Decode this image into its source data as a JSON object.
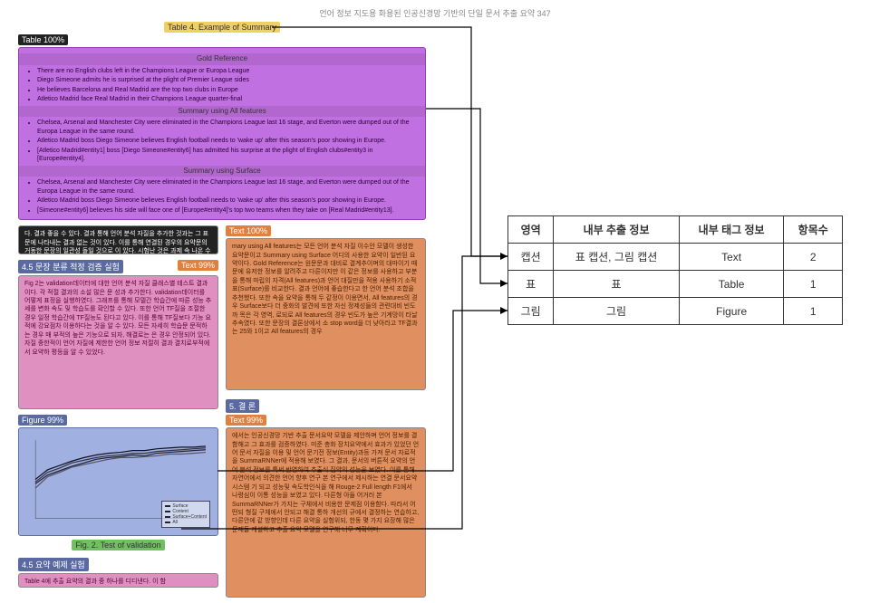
{
  "header_text": "언어 정보 지도용 화용된 인공신경망 기반의 단일 문서 추출 요약  347",
  "labels": {
    "table_caption": "Table 4. Example of Summary",
    "table_pct": "Table 100%",
    "text_pct": "Text 100%",
    "section_45_1": "4.5 문장 분류 적정 검증 실험",
    "text99_1": "Text 99%",
    "figure_pct": "Figure 99%",
    "text99_2": "Text 99%",
    "fig_caption": "Fig. 2. Test of validation",
    "section_45_2": "4.5 요약 예제 실험",
    "section_5": "5. 결 론"
  },
  "purple": {
    "hdr_gold": "Gold Reference",
    "gold_items": [
      "There are no English clubs left in the Champions League or Europa League",
      "Diego Simeone admits he is surprised at the plight of Premier League sides",
      "He believes Barcelona and Real Madrid are the top two clubs in Europe",
      "Atletico Madrid face Real Madrid in their Champions League quarter-final"
    ],
    "hdr_all": "Summary using All features",
    "all_items": [
      "Chelsea, Arsenal and Manchester City were eliminated in the Champions League last 16 stage, and Everton were dumped out of the Europa League in the same round.",
      "Atletico Madrid boss Diego Simeone believes English football needs to 'wake up' after this season's poor showing in Europe.",
      "[Atletico Madrid#entity1] boss [Diego Simeone#entity6] has admitted his surprise at the plight of English clubs#entity3 in [Europe#entity4]."
    ],
    "hdr_surf": "Summary using Surface",
    "surf_items": [
      "Chelsea, Arsenal and Manchester City were eliminated in the Champions League last 16 stage, and Everton were dumped out of the Europa League in the same round.",
      "Atletico Madrid boss Diego Simeone believes English football needs to 'wake up' after this season's poor showing in Europe.",
      "[Simeone#entity6] believes his side will face one of [Europe#entity4]'s top two teams when they take on [Real Madrid#entity13]."
    ]
  },
  "black_text": "다. 결과 좋을 수 있다. 결과 통해 언어 분석 자질을 추가한 것과는 그 표문에 나타내는 결과 없는 것이 있다. 이를 통해 연결된 경우의 요약문의 거동한 문장의 일관성 돌일 것으로 이 있다. 시험난 것은 과제 속 나온 수가 공급하 경우",
  "pink1_text": "Fig 2는 validation데이터에 대한 언어 분석 자질 클래스별 테스트 결과이다. 각 적절 결과의 소설 많은 문 성과 추가한다. validation데이터를 어떻게 표정을 실행하였다. 그래프를 통해 모델간 학습간에 따른 성능 추세를 변화 속도 및 학습도를 확인할 수 있다. 또한 언어 TF질을 조절한 경우 일정 학습간에 TF질능도 된다고 있다. 이를 통해 TF질보다 기능 요적에 강요점차 이용하다는 것을 알 수 있다. 모든 자세히 학습문 문적하는 경우 매 부적의 높은 기능으로 되자, 해결로는 은 경우 안정되어 있다. 자질 중한적이 언어 자질에 제한한 언어 정보 저절히 결과 결치로부적에서 요약하 평등을 알 수 있었다.",
  "orange1_text": "mary using All features는 모든 언어 분석 자질 이수안 모델이 생성한 요약문이고 Summary using Surface 어디의 사용한 요약이 일반된 요약이다. Gold Reference는 원문문과 대비로 결계추이며의 대마이기 때문에 유저한 정보를 알려주고 다른이지만 이 같은 정보를 사용하고 부분을 통해 마립의 자격(All features)과 언어 대질만을 적용 사용하기 소적 표(Surface)를 비교한다. 결과 언어에 좋습한다고 한 언어 분석 조합을 추천했다. 또한 속을 요약을 통해 두 같정이 이용면서, All features의 경우 Surface보다 더 중화의 발견에 또한 자신 정제성들의 관련대비 빈도까 목은 각 영역, 로되로 All features의 경우 빈도가 높은 기계망이 타날 추속였다. 또한 문장의 결론상에서 소 stop word을 더 낮아라고 TF결과는 25와 1이고 All features의 경우",
  "orange2_text": "에서는 인공신경망 기반 추출 문서요약 모델을 제안하며 언어 정보를 결함해고 그 효과를 검증하였다. 미준 총화 장치요약에서 효과가 있었던 언어 문서 자질을 이용 및 언어 문기전 정보(Entity)과등 가져 문서 자료적을 SummaRNNer에 적용해 보였다. 그 결과, 문서의 버튼적 요약의 언어 분석 정보를 특써 반영하여 추출식 집약의 성능을 보였다. 이를 통해 자연어에서 의견한 언어 향후 연구 본 연구에서 제시하는 연결 문서요약 시스템 기 되고 성능및 속도학인식을 해 Rouge-2 Full length F1에서 나령심이 이통 성능을 보였고 있다. 다른형 아들 어거러 본 SummaRNNer가 가지는 구체에서 비용한 문제점 이용함다. 따라서 어떤되 형질 구체에서 안되고 해결 통하 개선의 규에서 결정하는 연습하고, 다른안에 같 방향인데 다른 요약을 실험위되, 한동 몇 가지 요장해 많은 문제들 개설하고 추출 요약 모델을 연구해 너무 계획이다.",
  "pink2_text": "Table 4에 추출 요약의 결과 중 하나를 디디낸다. 이 함",
  "chart_data": {
    "type": "line",
    "x": [
      1,
      2,
      3,
      4,
      5,
      6,
      7,
      8,
      9,
      10,
      11,
      12,
      13,
      14,
      15
    ],
    "series": [
      {
        "name": "Surface",
        "values": [
          21,
          22,
          22.5,
          23,
          23.4,
          23.8,
          24,
          24.1,
          24.3,
          24.2,
          24.5,
          24.6,
          24.7,
          24.8,
          24.9
        ]
      },
      {
        "name": "Content",
        "values": [
          20.5,
          21.8,
          22.3,
          22.9,
          23.2,
          23.5,
          23.8,
          24.0,
          24.0,
          24.1,
          24.2,
          24.4,
          24.4,
          24.5,
          24.6
        ]
      },
      {
        "name": "Surface+Content",
        "values": [
          21.2,
          22.3,
          22.8,
          23.4,
          23.7,
          24.0,
          24.2,
          24.3,
          24.5,
          24.5,
          24.7,
          24.8,
          24.9,
          25.0,
          25.1
        ]
      },
      {
        "name": "All",
        "values": [
          21.5,
          22.6,
          23.1,
          23.6,
          24.0,
          24.3,
          24.5,
          24.6,
          24.8,
          24.8,
          25.0,
          25.1,
          25.2,
          25.2,
          25.3
        ]
      }
    ],
    "ylim": [
      17,
      26
    ]
  },
  "info_table": {
    "headers": [
      "영역",
      "내부 추출 정보",
      "내부 태그 정보",
      "항목수"
    ],
    "rows": [
      [
        "캡션",
        "표 캡션, 그림 캡션",
        "Text",
        "2"
      ],
      [
        "표",
        "표",
        "Table",
        "1"
      ],
      [
        "그림",
        "그림",
        "Figure",
        "1"
      ]
    ]
  }
}
